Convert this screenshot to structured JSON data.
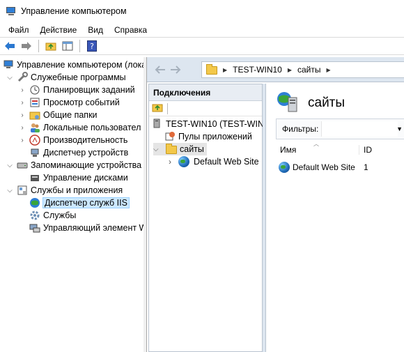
{
  "window": {
    "title": "Управление компьютером"
  },
  "menu": [
    "Файл",
    "Действие",
    "Вид",
    "Справка"
  ],
  "left_tree": {
    "root": "Управление компьютером (лока",
    "items": [
      "Служебные программы",
      "Планировщик заданий",
      "Просмотр событий",
      "Общие папки",
      "Локальные пользовател",
      "Производительность",
      "Диспетчер устройств",
      "Запоминающие устройства",
      "Управление дисками",
      "Службы и приложения",
      "Диспетчер служб IIS",
      "Службы",
      "Управляющий элемент W"
    ]
  },
  "iis": {
    "address": {
      "host": "TEST-WIN10",
      "node": "сайты"
    },
    "connections": {
      "header": "Подключения",
      "server": "TEST-WIN10 (TEST-WIN10\\",
      "app_pools": "Пулы приложений",
      "sites": "сайты",
      "default_site": "Default Web Site"
    },
    "content": {
      "title": "сайты",
      "filter_label": "Фильтры:",
      "columns": [
        "Имя",
        "ID"
      ],
      "rows": [
        {
          "name": "Default Web Site",
          "id": "1"
        }
      ]
    }
  },
  "colors": {
    "accent": "#2f7fd6",
    "selection": "#cce8ff",
    "iis_nav_bg": "#dde6f0"
  }
}
